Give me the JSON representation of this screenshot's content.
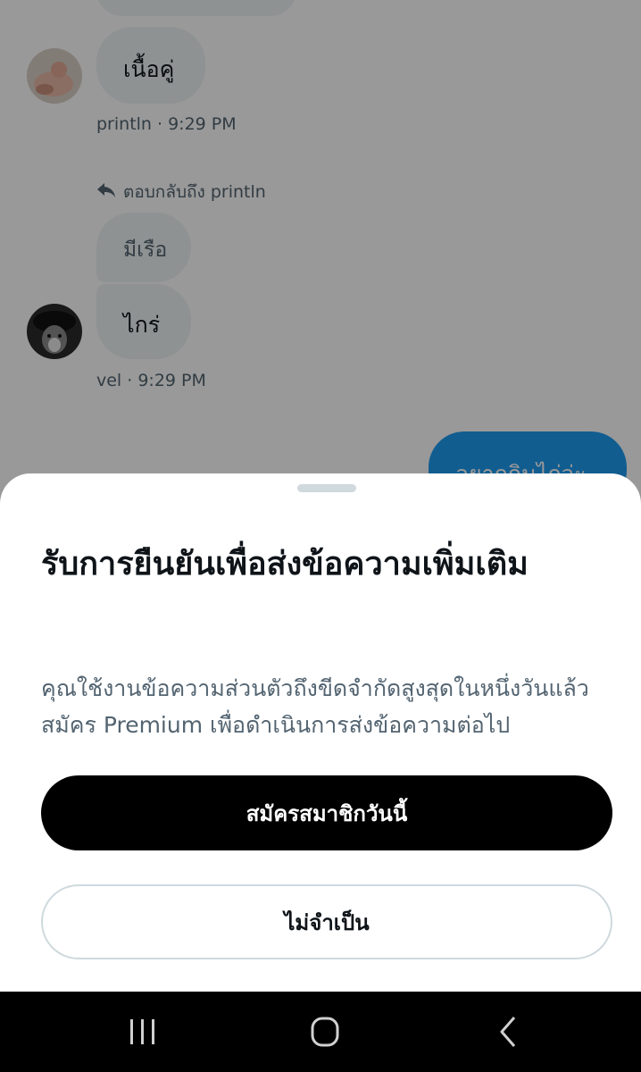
{
  "conversation": {
    "messages": [
      {
        "text": "เนื้อคู่"
      },
      {
        "meta": "println · 9:29 PM"
      },
      {
        "reply_to": "ตอบกลับถึง println"
      },
      {
        "text": "มีเรือ"
      },
      {
        "text": "ไกร่"
      },
      {
        "meta": "vel · 9:29 PM"
      },
      {
        "text": "อยากกินไก่ว่ะ"
      }
    ]
  },
  "sheet": {
    "title": "รับการยืนยันเพื่อส่งข้อความเพิ่มเติม",
    "body": "คุณใช้งานข้อความส่วนตัวถึงขีดจำกัดสูงสุดในหนึ่งวันแล้ว สมัคร Premium เพื่อดำเนินการส่งข้อความต่อไป",
    "primary_button": "สมัครสมาชิกวันนี้",
    "secondary_button": "ไม่จำเป็น"
  },
  "colors": {
    "accent": "#1d9bf0",
    "primary_button_bg": "#000000",
    "secondary_text": "#536471"
  },
  "icons": {
    "reply": "reply-arrow-icon",
    "nav_recent": "recent-apps-icon",
    "nav_home": "home-icon",
    "nav_back": "back-icon"
  }
}
